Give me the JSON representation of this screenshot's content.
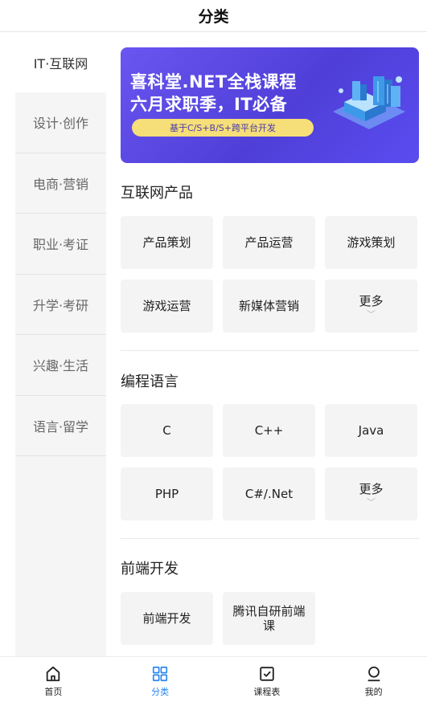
{
  "header": {
    "title": "分类"
  },
  "sidebar": {
    "items": [
      {
        "label": "IT·互联网"
      },
      {
        "label": "设计·创作"
      },
      {
        "label": "电商·营销"
      },
      {
        "label": "职业·考证"
      },
      {
        "label": "升学·考研"
      },
      {
        "label": "兴趣·生活"
      },
      {
        "label": "语言·留学"
      }
    ],
    "active_index": 0
  },
  "banner": {
    "line1": "喜科堂.NET全栈课程",
    "line2": "六月求职季，IT必备",
    "pill": "基于C/S+B/S+跨平台开发",
    "colors": {
      "bg": "#5a4ae6",
      "pill": "#f6de79"
    }
  },
  "sections": [
    {
      "title": "互联网产品",
      "items": [
        "产品策划",
        "产品运营",
        "游戏策划",
        "游戏运营",
        "新媒体营销"
      ],
      "more_label": "更多"
    },
    {
      "title": "编程语言",
      "items": [
        "C",
        "C++",
        "Java",
        "PHP",
        "C#/.Net"
      ],
      "more_label": "更多"
    },
    {
      "title": "前端开发",
      "items": [
        "前端开发",
        "腾讯自研前端课"
      ]
    }
  ],
  "tabbar": {
    "items": [
      {
        "label": "首页",
        "icon": "home-icon"
      },
      {
        "label": "分类",
        "icon": "category-icon"
      },
      {
        "label": "课程表",
        "icon": "schedule-icon"
      },
      {
        "label": "我的",
        "icon": "profile-icon"
      }
    ],
    "active_index": 1,
    "active_color": "#2a86f0"
  }
}
